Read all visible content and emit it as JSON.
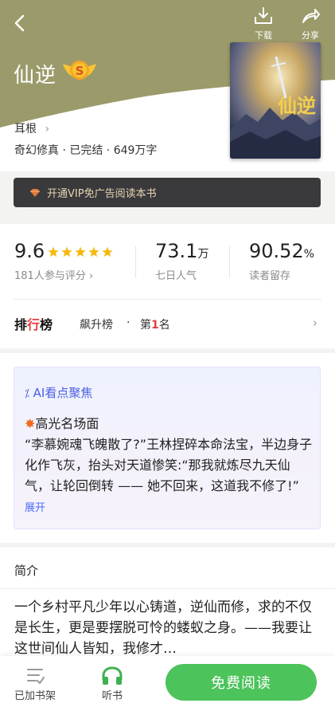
{
  "header": {
    "download_label": "下载",
    "share_label": "分享",
    "badge_letter": "S"
  },
  "book": {
    "title": "仙逆",
    "author": "耳根",
    "meta": "奇幻修真 · 已完结 · 649万字",
    "cover_text": "仙逆"
  },
  "vip_banner": {
    "label": "开通VIP免广告阅读本书"
  },
  "stats": {
    "rating": "9.6",
    "stars": 5,
    "rating_count": "181人参与评分",
    "popularity_value": "73.1",
    "popularity_unit": "万",
    "popularity_label": "七日人气",
    "retention_value": "90.52",
    "retention_unit": "%",
    "retention_label": "读者留存"
  },
  "ranking": {
    "title_a": "排",
    "title_b": "行",
    "title_c": "榜",
    "list_name": "飙升榜",
    "separator": "·",
    "pos_prefix": "第",
    "pos_num": "1",
    "pos_suffix": "名"
  },
  "ai": {
    "title": "AI看点聚焦",
    "subtitle": "高光名场面",
    "text": "“李慕婉魂飞魄散了?”王林捏碎本命法宝，半边身子化作飞灰，抬头对天道惨笑:“那我就炼尽九天仙气，让轮回倒转 —— 她不回来，这道我不修了!”",
    "expand": "展开"
  },
  "intro": {
    "heading": "简介",
    "text": "一个乡村平凡少年以心铸道，逆仙而修，求的不仅是长生，更是要摆脱可怜的蝼蚁之身。——我要让这世间仙人皆知，我修才…"
  },
  "bottom_bar": {
    "shelf_label": "已加书架",
    "listen_label": "听书",
    "read_label": "免费阅读"
  },
  "colors": {
    "hero_olive": "#9b9a6a",
    "accent_green": "#4cc35b",
    "rank_red": "#e33c3c",
    "ai_blue": "#4a5fe0",
    "star_gold": "#f5b90a"
  }
}
